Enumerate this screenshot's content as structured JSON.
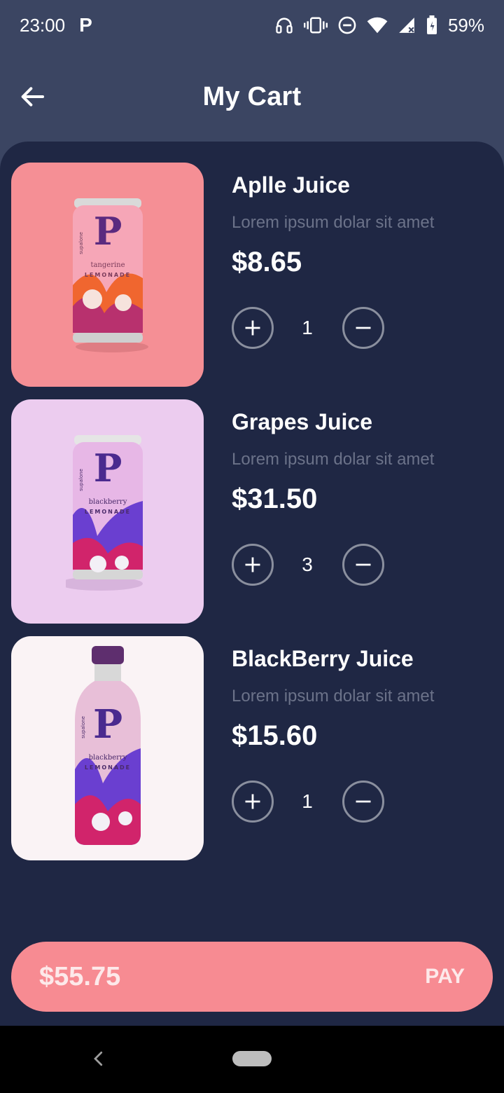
{
  "status_bar": {
    "time": "23:00",
    "app_icon": "P",
    "battery": "59%",
    "icons": [
      "headphones-icon",
      "vibrate-icon",
      "dnd-icon",
      "wifi-icon",
      "signal-icon",
      "battery-icon"
    ]
  },
  "header": {
    "title": "My Cart",
    "back_icon": "arrow-left-icon"
  },
  "cart": {
    "items": [
      {
        "name": "Aplle Juice",
        "description": "Lorem ipsum dolar sit amet",
        "price": "$8.65",
        "quantity": "1",
        "image_bg": "#f58f95",
        "can_color": "#f6a6b7",
        "logo": "P",
        "flavor": "tangerine",
        "kind": "LEMONADE",
        "brand": "supalone"
      },
      {
        "name": "Grapes Juice",
        "description": "Lorem ipsum dolar sit amet",
        "price": "$31.50",
        "quantity": "3",
        "image_bg": "#ecccef",
        "can_color": "#e7b7e6",
        "logo": "P",
        "flavor": "blackberry",
        "kind": "LEMONADE",
        "brand": "supalone"
      },
      {
        "name": "BlackBerry Juice",
        "description": "Lorem ipsum dolar sit amet",
        "price": "$15.60",
        "quantity": "1",
        "image_bg": "#faf3f5",
        "can_color": "#e8bfd8",
        "logo": "P",
        "flavor": "blackberry",
        "kind": "LEMONADE",
        "brand": "supalone"
      }
    ]
  },
  "checkout": {
    "total": "$55.75",
    "pay_label": "PAY"
  },
  "colors": {
    "header_bg": "#3b4562",
    "body_bg": "#1f2744",
    "accent": "#f78b92",
    "muted_text": "#6b7289"
  }
}
